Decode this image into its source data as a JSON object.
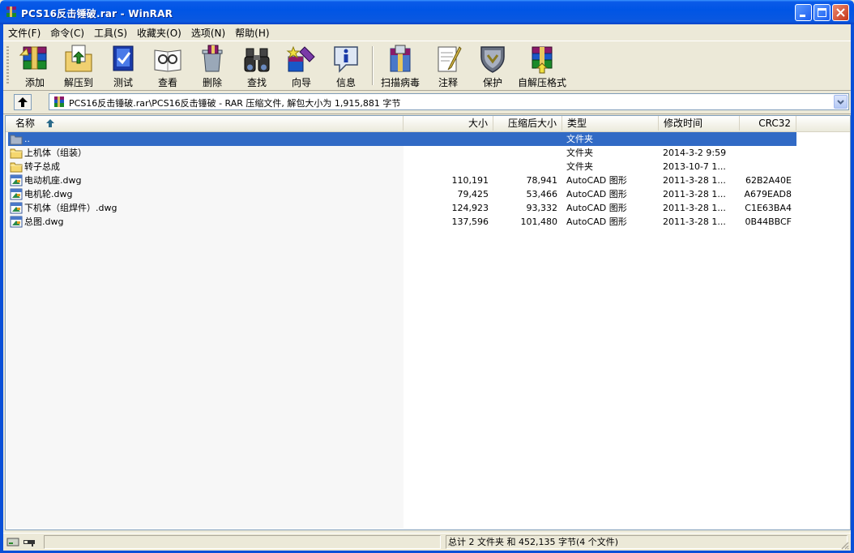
{
  "window": {
    "title": "PCS16反击锤破.rar - WinRAR"
  },
  "menu": [
    "文件(F)",
    "命令(C)",
    "工具(S)",
    "收藏夹(O)",
    "选项(N)",
    "帮助(H)"
  ],
  "toolbar": {
    "add": "添加",
    "extract_to": "解压到",
    "test": "测试",
    "view": "查看",
    "delete": "删除",
    "find": "查找",
    "wizard": "向导",
    "info": "信息",
    "virus_scan": "扫描病毒",
    "comment": "注释",
    "protect": "保护",
    "sfx": "自解压格式"
  },
  "address": {
    "path": "PCS16反击锤破.rar\\PCS16反击锤破 - RAR 压缩文件, 解包大小为 1,915,881 字节"
  },
  "columns": {
    "name": "名称",
    "size": "大小",
    "packed": "压缩后大小",
    "type": "类型",
    "modified": "修改时间",
    "crc": "CRC32"
  },
  "files": [
    {
      "name": "..",
      "size": "",
      "packed": "",
      "type": "文件夹",
      "modified": "",
      "crc": "",
      "icon": "folder-up-icon",
      "selected": true
    },
    {
      "name": "上机体（组装）",
      "size": "",
      "packed": "",
      "type": "文件夹",
      "modified": "2014-3-2 9:59",
      "crc": "",
      "icon": "folder-icon"
    },
    {
      "name": "转子总成",
      "size": "",
      "packed": "",
      "type": "文件夹",
      "modified": "2013-10-7 1...",
      "crc": "",
      "icon": "folder-icon"
    },
    {
      "name": "电动机座.dwg",
      "size": "110,191",
      "packed": "78,941",
      "type": "AutoCAD 图形",
      "modified": "2011-3-28 1...",
      "crc": "62B2A40E",
      "icon": "dwg-file-icon"
    },
    {
      "name": "电机轮.dwg",
      "size": "79,425",
      "packed": "53,466",
      "type": "AutoCAD 图形",
      "modified": "2011-3-28 1...",
      "crc": "A679EAD8",
      "icon": "dwg-file-icon"
    },
    {
      "name": "下机体（组焊件）.dwg",
      "size": "124,923",
      "packed": "93,332",
      "type": "AutoCAD 图形",
      "modified": "2011-3-28 1...",
      "crc": "C1E63BA4",
      "icon": "dwg-file-icon"
    },
    {
      "name": "总图.dwg",
      "size": "137,596",
      "packed": "101,480",
      "type": "AutoCAD 图形",
      "modified": "2011-3-28 1...",
      "crc": "0B44BBCF",
      "icon": "dwg-file-icon"
    }
  ],
  "status": {
    "left": "",
    "right": "总计 2 文件夹 和 452,135 字节(4 个文件)"
  },
  "colors": {
    "titlebar": "#0055e5",
    "selection": "#316ac5",
    "face": "#ece9d8"
  }
}
